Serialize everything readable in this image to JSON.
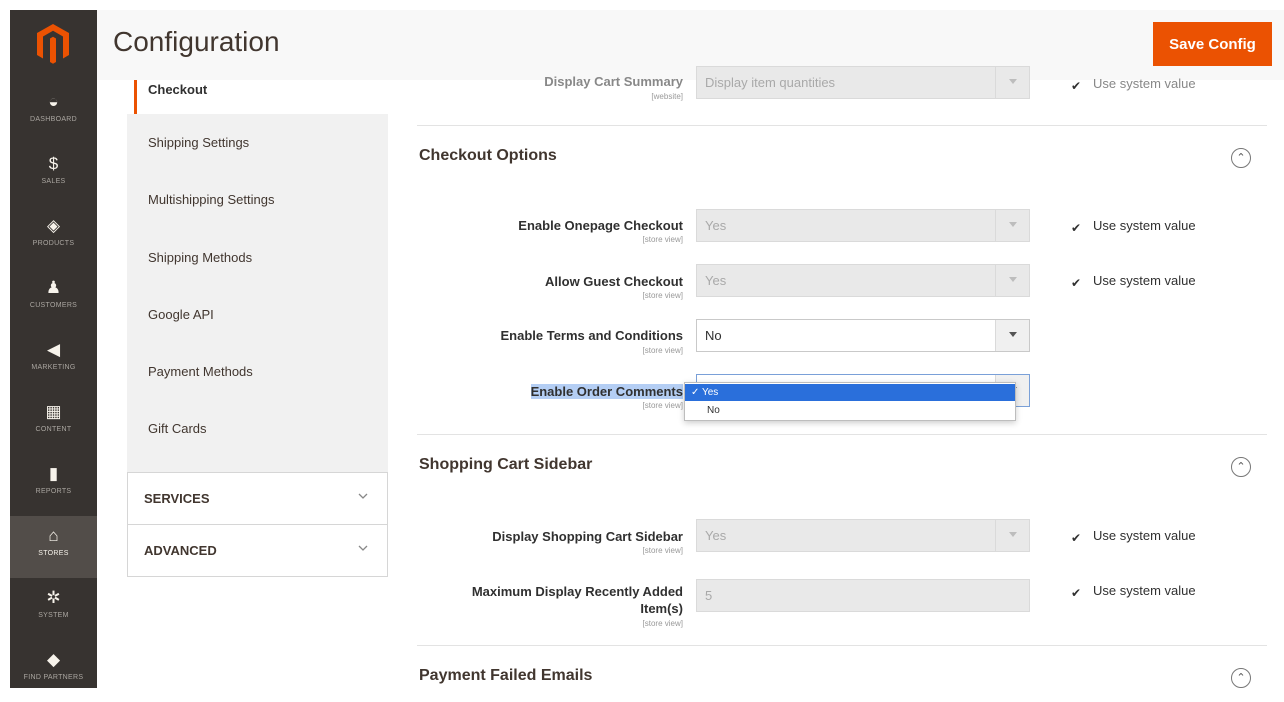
{
  "colors": {
    "accent": "#eb5202",
    "nav_bg": "#373330",
    "selection": "#2a6fdb"
  },
  "admin_nav": {
    "items": [
      {
        "label": "DASHBOARD",
        "icon": "dashboard-icon"
      },
      {
        "label": "SALES",
        "icon": "dollar-icon"
      },
      {
        "label": "PRODUCTS",
        "icon": "box-icon"
      },
      {
        "label": "CUSTOMERS",
        "icon": "person-icon"
      },
      {
        "label": "MARKETING",
        "icon": "megaphone-icon"
      },
      {
        "label": "CONTENT",
        "icon": "layout-icon"
      },
      {
        "label": "REPORTS",
        "icon": "bar-chart-icon"
      },
      {
        "label": "STORES",
        "icon": "store-icon"
      },
      {
        "label": "SYSTEM",
        "icon": "gear-icon"
      },
      {
        "label": "FIND PARTNERS",
        "icon": "partners-icon"
      }
    ]
  },
  "header": {
    "title": "Configuration",
    "save_label": "Save Config"
  },
  "tabs": {
    "active": "Checkout",
    "items": [
      "Shipping Settings",
      "Multishipping Settings",
      "Shipping Methods",
      "Google API",
      "Payment Methods",
      "Gift Cards"
    ],
    "sections": [
      "SERVICES",
      "ADVANCED"
    ]
  },
  "top_row": {
    "label": "Display Cart Summary",
    "scope": "[website]",
    "value": "Display item quantities",
    "system": "Use system value"
  },
  "checkout_options": {
    "title": "Checkout Options",
    "rows": [
      {
        "label": "Enable Onepage Checkout",
        "scope": "[store view]",
        "value": "Yes",
        "system": "Use system value"
      },
      {
        "label": "Allow Guest Checkout",
        "scope": "[store view]",
        "value": "Yes",
        "system": "Use system value"
      },
      {
        "label": "Enable Terms and Conditions",
        "scope": "[store view]",
        "value": "No"
      },
      {
        "label": "Enable Order Comments",
        "scope": "[store view]",
        "value": "Yes"
      }
    ]
  },
  "dropdown": {
    "options": [
      "Yes",
      "No"
    ],
    "selected": "Yes"
  },
  "sidebar_section": {
    "title": "Shopping Cart Sidebar",
    "rows": [
      {
        "label": "Display Shopping Cart Sidebar",
        "scope": "[store view]",
        "value": "Yes",
        "system": "Use system value"
      },
      {
        "label": "Maximum Display Recently Added",
        "label2": "Item(s)",
        "scope": "[store view]",
        "value": "5",
        "system": "Use system value"
      }
    ]
  },
  "payment_failed": {
    "title": "Payment Failed Emails"
  }
}
